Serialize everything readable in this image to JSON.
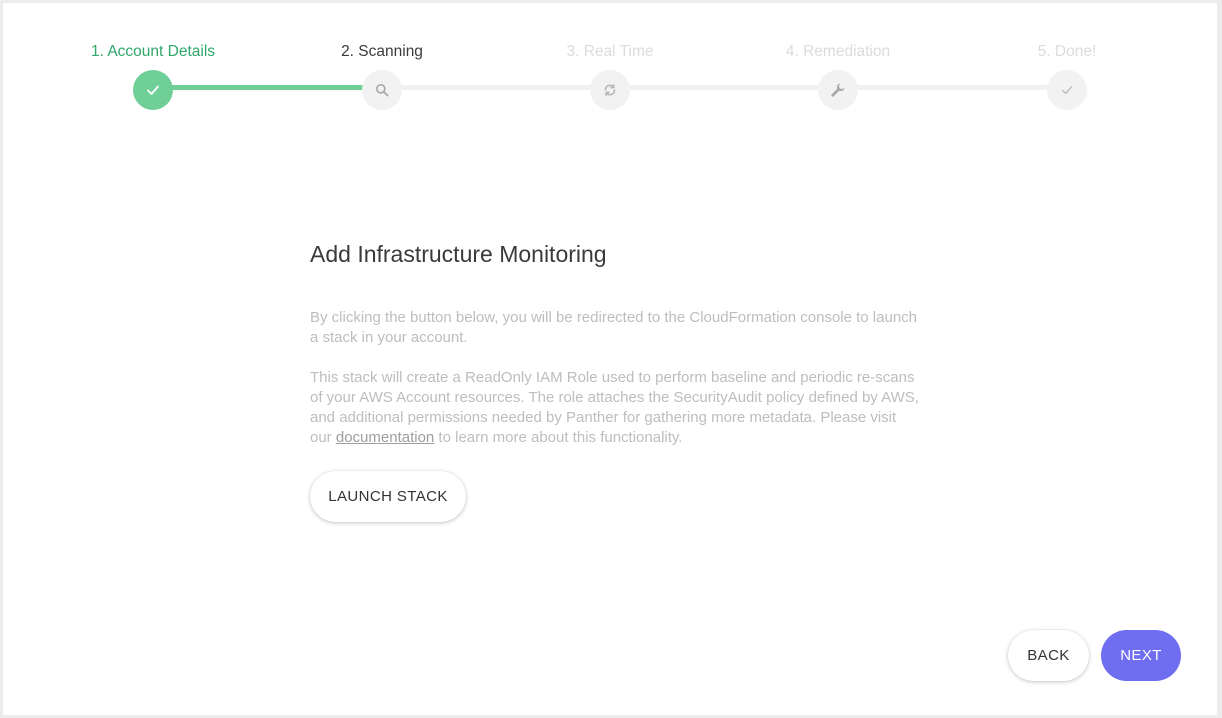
{
  "stepper": {
    "steps": [
      {
        "label": "1. Account Details",
        "state": "complete",
        "icon": "check-icon"
      },
      {
        "label": "2. Scanning",
        "state": "current",
        "icon": "search-icon"
      },
      {
        "label": "3. Real Time",
        "state": "pending",
        "icon": "sync-icon"
      },
      {
        "label": "4. Remediation",
        "state": "pending",
        "icon": "wrench-icon"
      },
      {
        "label": "5. Done!",
        "state": "pending",
        "icon": "check-icon"
      }
    ]
  },
  "main": {
    "title": "Add Infrastructure Monitoring",
    "paragraph1": "By clicking the button below, you will be redirected to the CloudFormation console to launch a stack in your account.",
    "paragraph2_before": "This stack will create a ReadOnly IAM Role used to perform baseline and periodic re-scans of your AWS Account resources. The role attaches the SecurityAudit policy defined by AWS, and additional permissions needed by Panther for gathering more metadata. Please visit our ",
    "paragraph2_link": "documentation",
    "paragraph2_after": " to learn more about this functionality.",
    "launch_label": "LAUNCH STACK"
  },
  "footer": {
    "back_label": "BACK",
    "next_label": "NEXT"
  },
  "colors": {
    "accent_green": "#6fcf97",
    "label_green": "#2fa869",
    "primary_purple": "#6f6ef0"
  }
}
